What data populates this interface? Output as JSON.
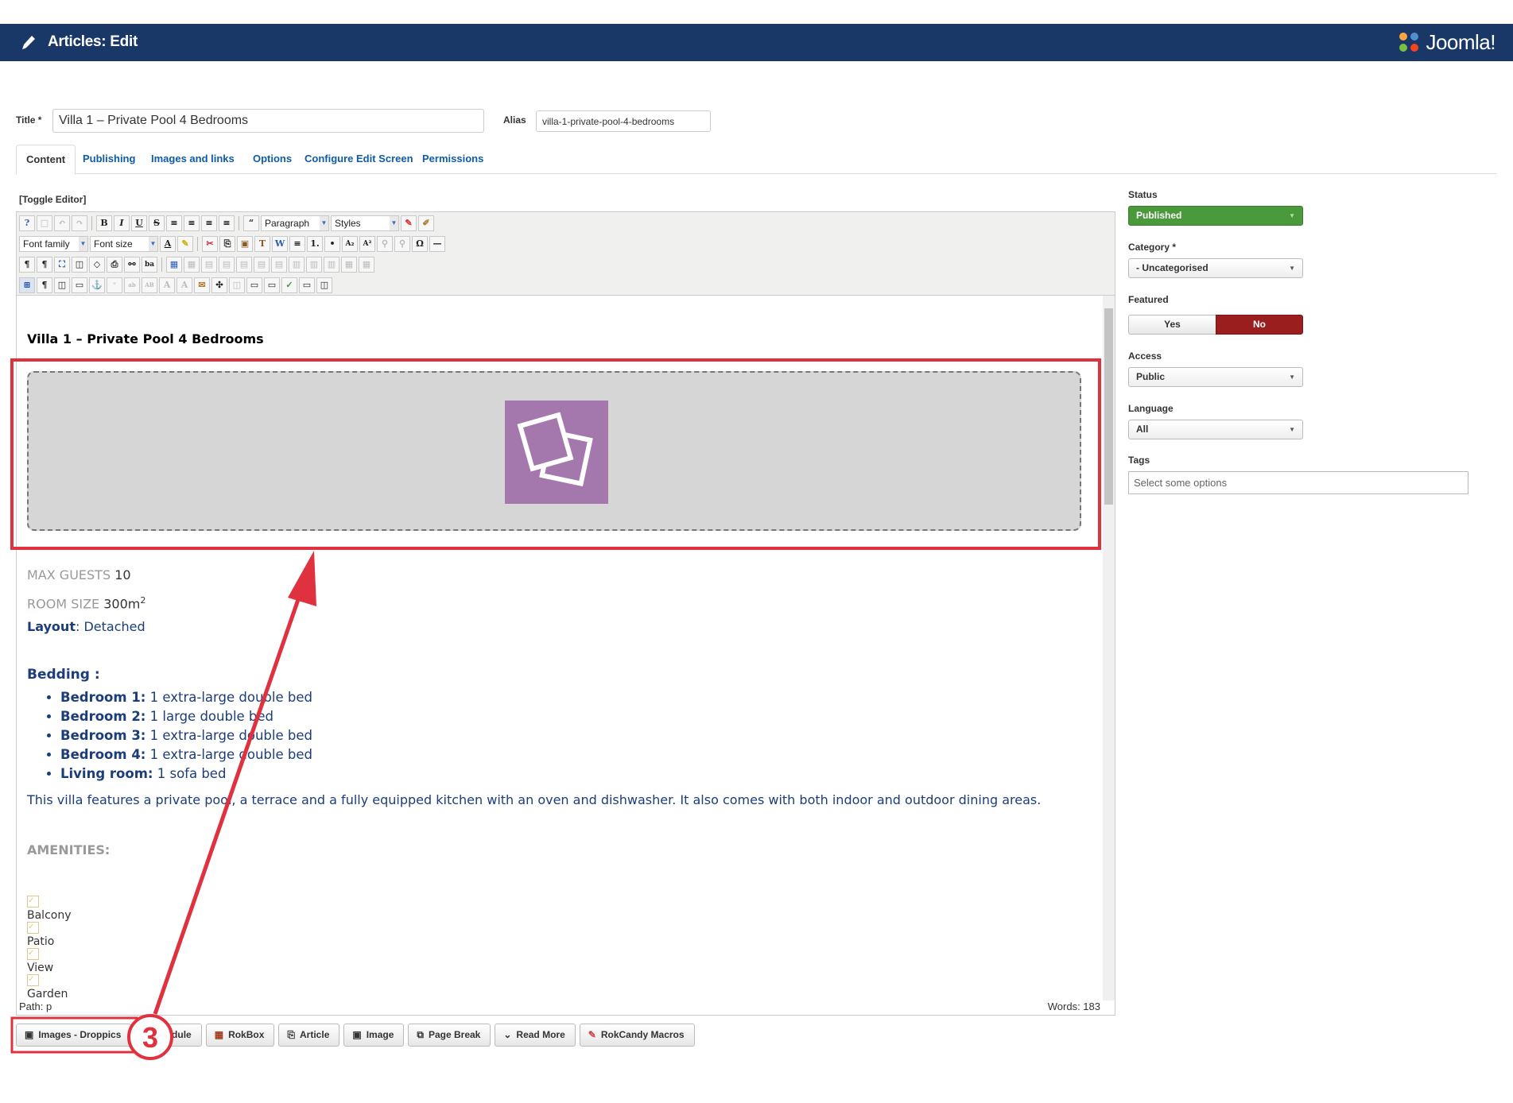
{
  "header": {
    "title": "Articles: Edit",
    "brand": "Joomla!"
  },
  "form": {
    "title_label": "Title *",
    "title_value": "Villa 1 – Private Pool 4 Bedrooms",
    "alias_label": "Alias",
    "alias_value": "villa-1-private-pool-4-bedrooms"
  },
  "tabs": [
    "Content",
    "Publishing",
    "Images and links",
    "Options",
    "Configure Edit Screen",
    "Permissions"
  ],
  "editor": {
    "toggle_label": "[Toggle Editor]",
    "toolbar": {
      "format_select": "Paragraph",
      "styles_select": "Styles",
      "font_family": "Font family",
      "font_size": "Font size"
    },
    "content": {
      "heading": "Villa 1 – Private Pool 4 Bedrooms",
      "max_guests_label": "MAX GUESTS",
      "max_guests_value": "10",
      "room_size_label": "ROOM SIZE",
      "room_size_value": "300m",
      "room_size_sup": "2",
      "layout_label": "Layout",
      "layout_value": ": Detached",
      "bedding_label": "Bedding :",
      "bedrooms": [
        {
          "name": "Bedroom 1:",
          "value": " 1 extra-large double bed"
        },
        {
          "name": "Bedroom 2:",
          "value": " 1 large double bed"
        },
        {
          "name": "Bedroom 3:",
          "value": " 1 extra-large double bed"
        },
        {
          "name": "Bedroom 4:",
          "value": " 1 extra-large double bed"
        },
        {
          "name": "Living room:",
          "value": " 1 sofa bed"
        }
      ],
      "description": "This villa features a private pool, a terrace and a fully equipped kitchen with an oven and dishwasher. It also comes with both indoor and outdoor dining areas.",
      "amenities_label": "AMENITIES:",
      "amenities": [
        "Balcony",
        "Patio",
        "View",
        "Garden"
      ]
    },
    "path": "Path: p",
    "words": "Words: 183"
  },
  "buttons": [
    "Images - Droppics",
    "Module",
    "RokBox",
    "Article",
    "Image",
    "Page Break",
    "Read More",
    "RokCandy Macros"
  ],
  "sidebar": {
    "status_label": "Status",
    "status_value": "Published",
    "category_label": "Category *",
    "category_value": "- Uncategorised",
    "featured_label": "Featured",
    "featured_yes": "Yes",
    "featured_no": "No",
    "access_label": "Access",
    "access_value": "Public",
    "language_label": "Language",
    "language_value": "All",
    "tags_label": "Tags",
    "tags_placeholder": "Select some options"
  },
  "annotation": {
    "step_number": "3",
    "color": "#e0313f"
  },
  "colors": {
    "header_bg": "#1a3867",
    "published_green": "#4a9a3c",
    "featured_no_red": "#9b1e1e",
    "gallery_purple": "#a478ad",
    "link_blue": "#0e5ca8"
  }
}
